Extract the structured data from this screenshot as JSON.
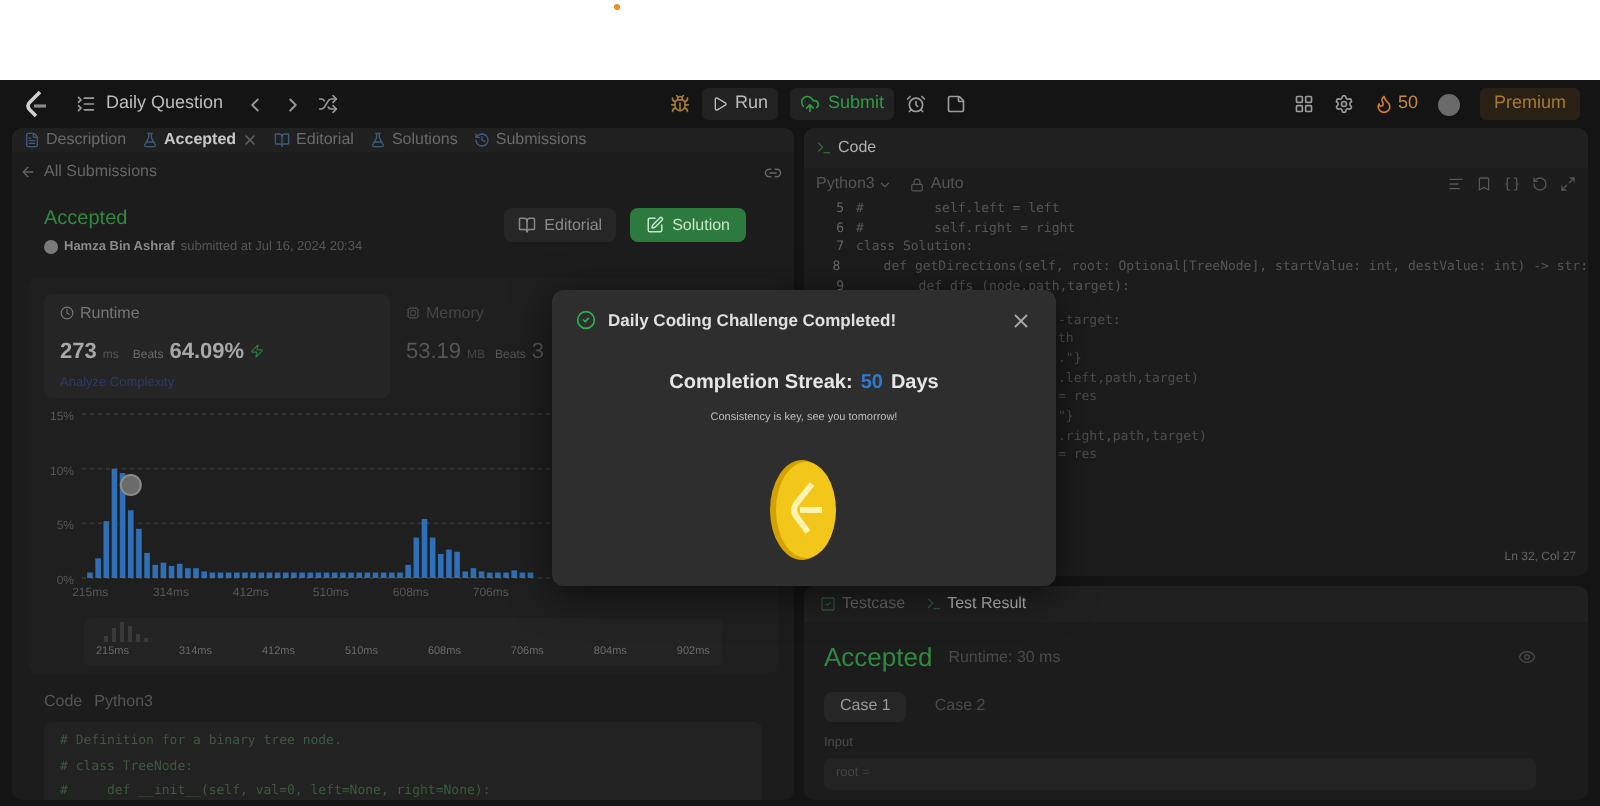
{
  "nav": {
    "title": "Daily Question",
    "run": "Run",
    "submit": "Submit",
    "streak": "50",
    "premium": "Premium"
  },
  "left": {
    "tabs": [
      {
        "label": "Description",
        "selected": false,
        "closable": false
      },
      {
        "label": "Accepted",
        "selected": true,
        "closable": true
      },
      {
        "label": "Editorial",
        "selected": false,
        "closable": false
      },
      {
        "label": "Solutions",
        "selected": false,
        "closable": false
      },
      {
        "label": "Submissions",
        "selected": false,
        "closable": false
      }
    ],
    "back": "All Submissions",
    "status": "Accepted",
    "author": "Hamza Bin Ashraf",
    "submitted": "submitted at Jul 16, 2024 20:34",
    "editorial_button": "Editorial",
    "solution_button": "Solution",
    "runtime": {
      "label": "Runtime",
      "value": "273",
      "unit": "ms",
      "beats_label": "Beats",
      "beats": "64.09%",
      "analyze": "Analyze Complexity"
    },
    "memory": {
      "label": "Memory",
      "value": "53.19",
      "unit": "MB",
      "beats_label": "Beats",
      "beats": "3"
    },
    "chart_data": {
      "type": "bar",
      "x": [
        215,
        225,
        235,
        245,
        255,
        265,
        275,
        285,
        295,
        305,
        315,
        325,
        335,
        345,
        355,
        365,
        375,
        385,
        395,
        405,
        415,
        425,
        435,
        445,
        455,
        465,
        475,
        485,
        495,
        505,
        515,
        525,
        535,
        545,
        555,
        565,
        575,
        585,
        595,
        605,
        615,
        625,
        635,
        645,
        655,
        665,
        675,
        685,
        695,
        705,
        715,
        725,
        735,
        745,
        755
      ],
      "values": [
        0.5,
        1.8,
        5.2,
        10,
        9.6,
        6.2,
        4.5,
        2.3,
        1.2,
        1.4,
        1.1,
        1.3,
        0.9,
        0.9,
        0.6,
        0.5,
        0.5,
        0.5,
        0.5,
        0.5,
        0.5,
        0.5,
        0.5,
        0.5,
        0.5,
        0.5,
        0.5,
        0.5,
        0.5,
        0.5,
        0.5,
        0.5,
        0.5,
        0.5,
        0.5,
        0.5,
        0.5,
        0.5,
        0.5,
        1.2,
        3.7,
        5.4,
        3.7,
        2.2,
        2.6,
        2.4,
        0.6,
        0.9,
        0.6,
        0.5,
        0.5,
        0.5,
        0.7,
        0.5,
        0.5
      ],
      "xlim": [
        205,
        960
      ],
      "ylim": [
        0,
        15
      ],
      "xticks": [
        {
          "value": 215,
          "label": "215ms"
        },
        {
          "value": 314,
          "label": "314ms"
        },
        {
          "value": 412,
          "label": "412ms"
        },
        {
          "value": 510,
          "label": "510ms"
        },
        {
          "value": 608,
          "label": "608ms"
        },
        {
          "value": 706,
          "label": "706ms"
        }
      ],
      "yticks": [
        {
          "value": 0,
          "label": "0%"
        },
        {
          "value": 5,
          "label": "5%"
        },
        {
          "value": 10,
          "label": "10%"
        },
        {
          "value": 15,
          "label": "15%"
        }
      ]
    },
    "minimap_labels": [
      "215ms",
      "314ms",
      "412ms",
      "510ms",
      "608ms",
      "706ms",
      "804ms",
      "902ms"
    ],
    "code_label": "Code",
    "language": "Python3",
    "code": [
      "# Definition for a binary tree node.",
      "# class TreeNode:",
      "#     def __init__(self, val=0, left=None, right=None):"
    ]
  },
  "right": {
    "title": "Code",
    "language": "Python3",
    "mode": "Auto",
    "lines": [
      {
        "n": "5",
        "text": "#         self.left = left"
      },
      {
        "n": "6",
        "text": "#         self.right = right"
      },
      {
        "n": "7",
        "text": "class Solution:"
      },
      {
        "n": "8",
        "text": "    def getDirections(self, root: Optional[TreeNode], startValue: int, destValue: int) -> str:"
      },
      {
        "n": "9",
        "text": "        def dfs (node,path,target):"
      }
    ],
    "fragments": [
      "-target:",
      "th",
      ".\"}",
      ".left,path,target)",
      "= res",
      "\"}",
      ".right,path,target)",
      "= res"
    ],
    "cursor": "Ln 32, Col 27",
    "bottom_tabs": [
      {
        "label": "Testcase",
        "selected": false
      },
      {
        "label": "Test Result",
        "selected": true
      }
    ],
    "result": "Accepted",
    "runtime": "Runtime: 30 ms",
    "cases": [
      {
        "label": "Case 1",
        "selected": true
      },
      {
        "label": "Case 2",
        "selected": false
      }
    ],
    "input_label": "Input",
    "input_value": "root ="
  },
  "modal": {
    "title": "Daily Coding Challenge Completed!",
    "streak_label": "Completion Streak:",
    "streak": "50",
    "streak_unit": "Days",
    "message": "Consistency is key, see you tomorrow!"
  }
}
